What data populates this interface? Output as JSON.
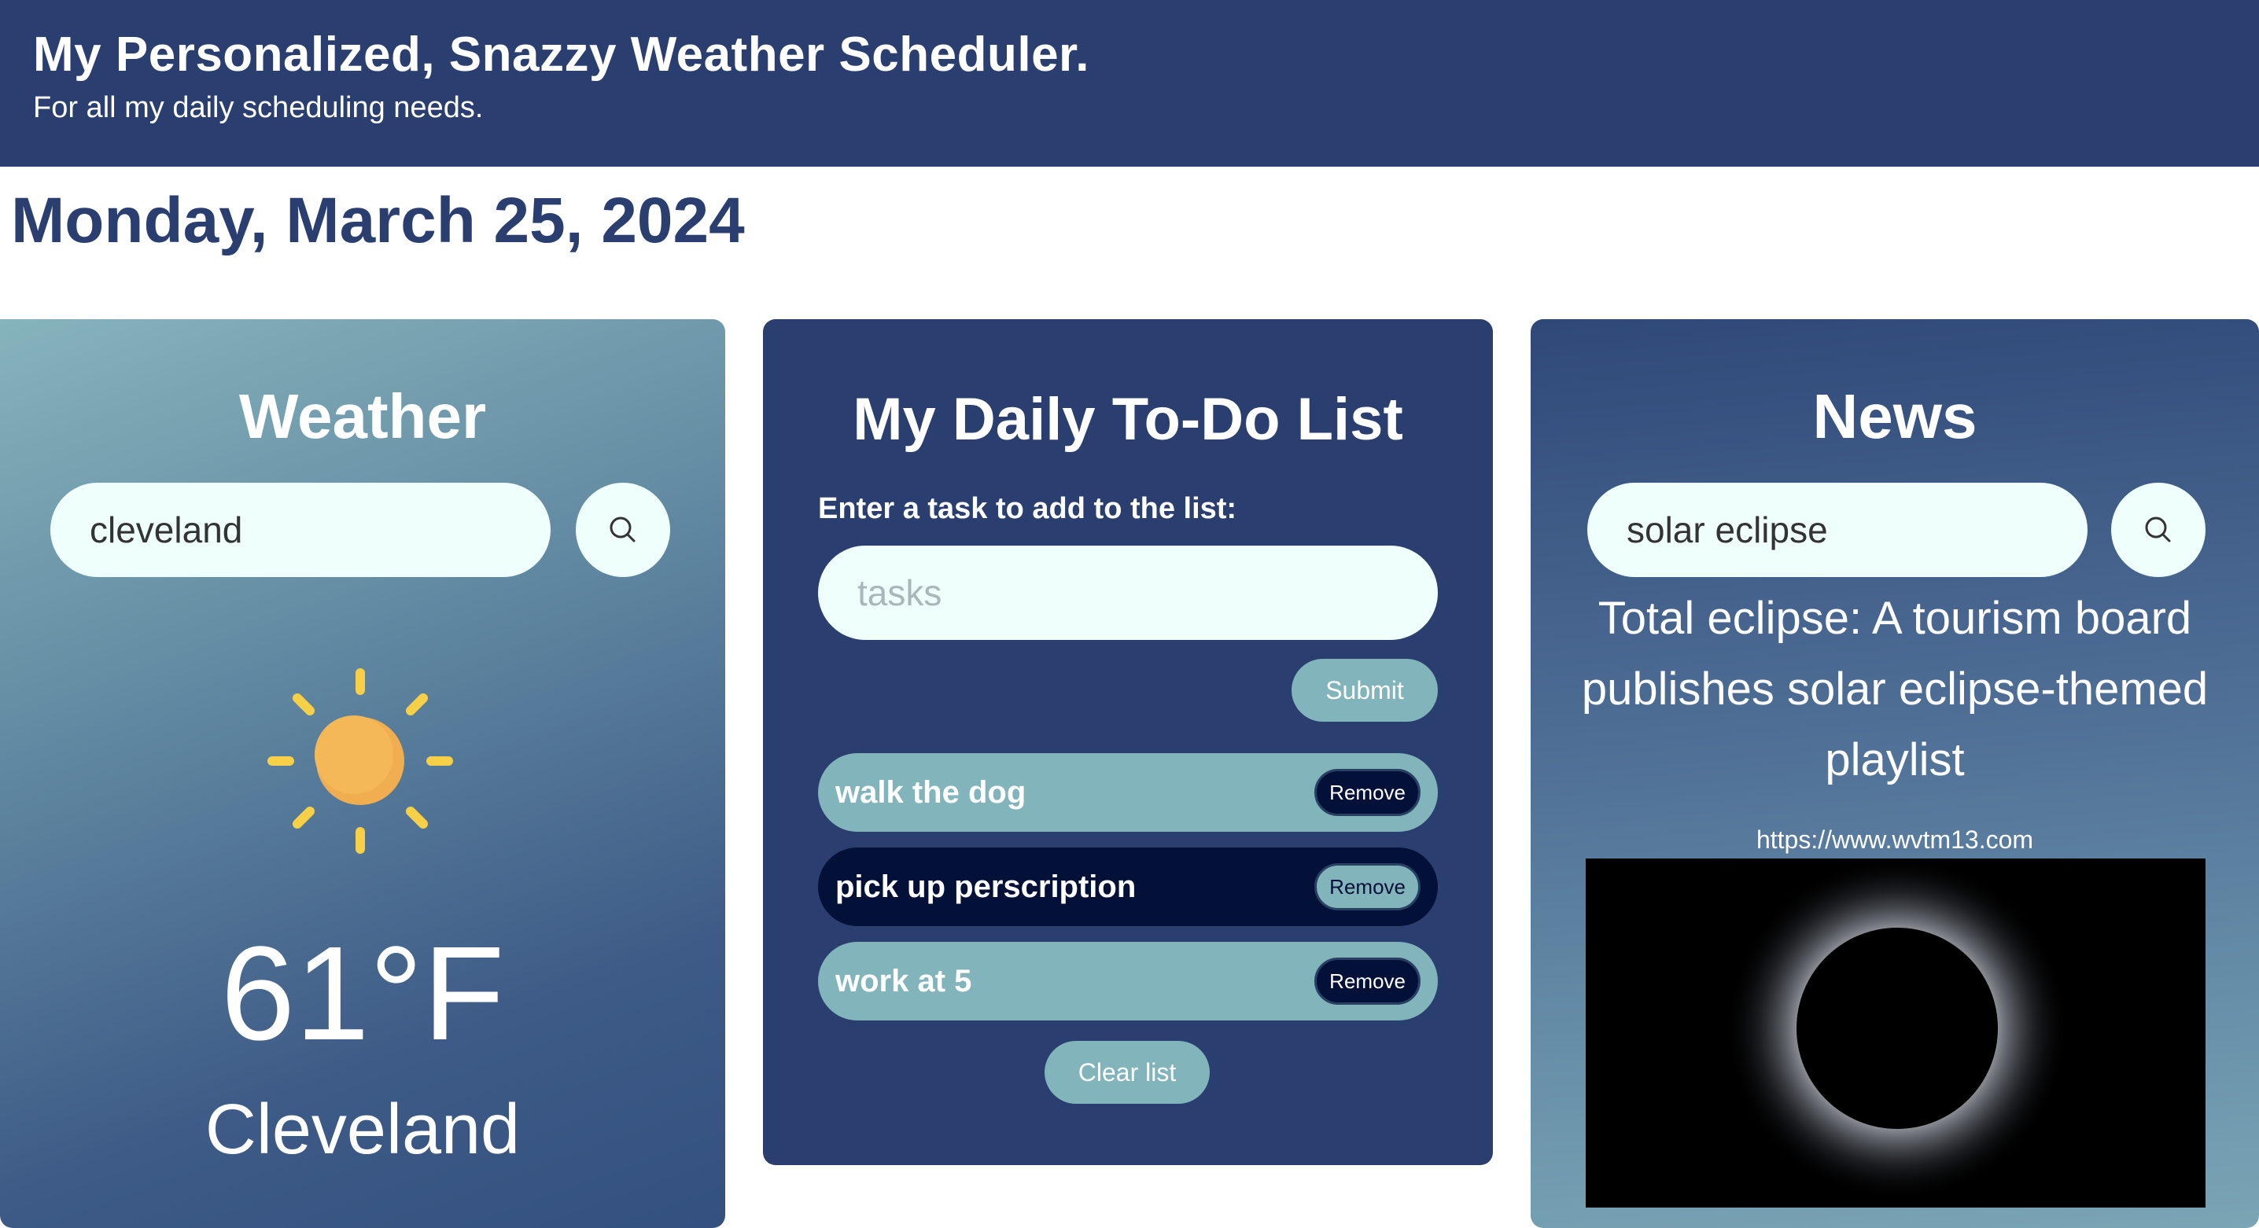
{
  "header": {
    "title": "My Personalized, Snazzy Weather Scheduler.",
    "subtitle": "For all my daily scheduling needs."
  },
  "date": "Monday, March 25, 2024",
  "weather": {
    "title": "Weather",
    "search_value": "cleveland",
    "search_icon": "search-icon",
    "condition_icon": "sun-icon",
    "temperature": "61°F",
    "city": "Cleveland"
  },
  "todo": {
    "title": "My Daily To-Do List",
    "input_label": "Enter a task to add to the list:",
    "input_placeholder": "tasks",
    "submit_label": "Submit",
    "tasks": [
      {
        "text": "walk the dog",
        "remove_label": "Remove"
      },
      {
        "text": "pick up perscription",
        "remove_label": "Remove"
      },
      {
        "text": "work at 5",
        "remove_label": "Remove"
      }
    ],
    "clear_label": "Clear list"
  },
  "news": {
    "title": "News",
    "search_value": "solar eclipse",
    "search_icon": "search-icon",
    "headline": "Total eclipse: A tourism board publishes solar eclipse-themed playlist",
    "url": "https://www.wvtm13.com"
  },
  "colors": {
    "header_bg": "#2a3f6f",
    "accent": "#81b4bb",
    "dark_task": "#031037",
    "input_bg": "#effffc"
  }
}
